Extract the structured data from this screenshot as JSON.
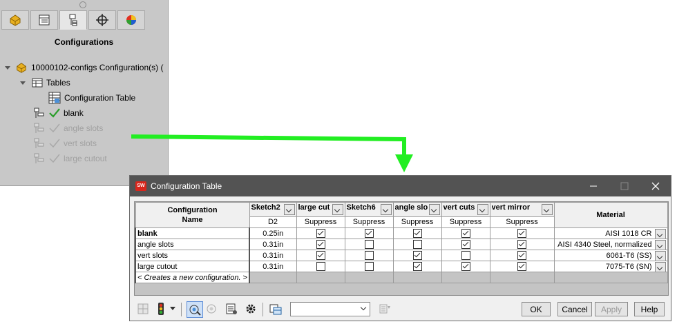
{
  "panel": {
    "title": "Configurations",
    "tabs": [
      "feature-manager-icon",
      "property-manager-icon",
      "configuration-manager-icon",
      "dimxpert-icon",
      "display-manager-icon"
    ],
    "tree": {
      "root": "10000102-configs Configuration(s)  (",
      "tables_label": "Tables",
      "config_table_label": "Configuration Table",
      "configs": [
        {
          "label": "blank",
          "active": true
        },
        {
          "label": "angle slots",
          "active": false
        },
        {
          "label": "vert slots",
          "active": false
        },
        {
          "label": "large cutout",
          "active": false
        }
      ]
    }
  },
  "arrow_color": "#22ee22",
  "dialog": {
    "title": "Configuration Table",
    "columns": [
      {
        "header": "Sketch2",
        "sub": "D2"
      },
      {
        "header": "large cut",
        "sub": "Suppress"
      },
      {
        "header": "Sketch6",
        "sub": "Suppress"
      },
      {
        "header": "angle slo",
        "sub": "Suppress"
      },
      {
        "header": "vert cuts",
        "sub": "Suppress"
      },
      {
        "header": "vert mirror",
        "sub": "Suppress"
      }
    ],
    "name_header_line1": "Configuration",
    "name_header_line2": "Name",
    "material_header": "Material",
    "rows": [
      {
        "name": "blank",
        "d2": "0.25in",
        "checks": [
          true,
          true,
          true,
          true,
          true
        ],
        "material": "AISI 1018 CR",
        "bold": true
      },
      {
        "name": "angle slots",
        "d2": "0.31in",
        "checks": [
          true,
          false,
          false,
          true,
          true
        ],
        "material": "AISI 4340 Steel, normalized",
        "bold": false
      },
      {
        "name": "vert slots",
        "d2": "0.31in",
        "checks": [
          true,
          false,
          true,
          false,
          true
        ],
        "material": "6061-T6 (SS)",
        "bold": false
      },
      {
        "name": "large cutout",
        "d2": "0.31in",
        "checks": [
          false,
          false,
          true,
          true,
          true
        ],
        "material": "7075-T6 (SN)",
        "bold": false
      }
    ],
    "new_row_label": "< Creates a new configuration. >",
    "buttons": {
      "ok": "OK",
      "cancel": "Cancel",
      "apply": "Apply",
      "help": "Help"
    }
  }
}
